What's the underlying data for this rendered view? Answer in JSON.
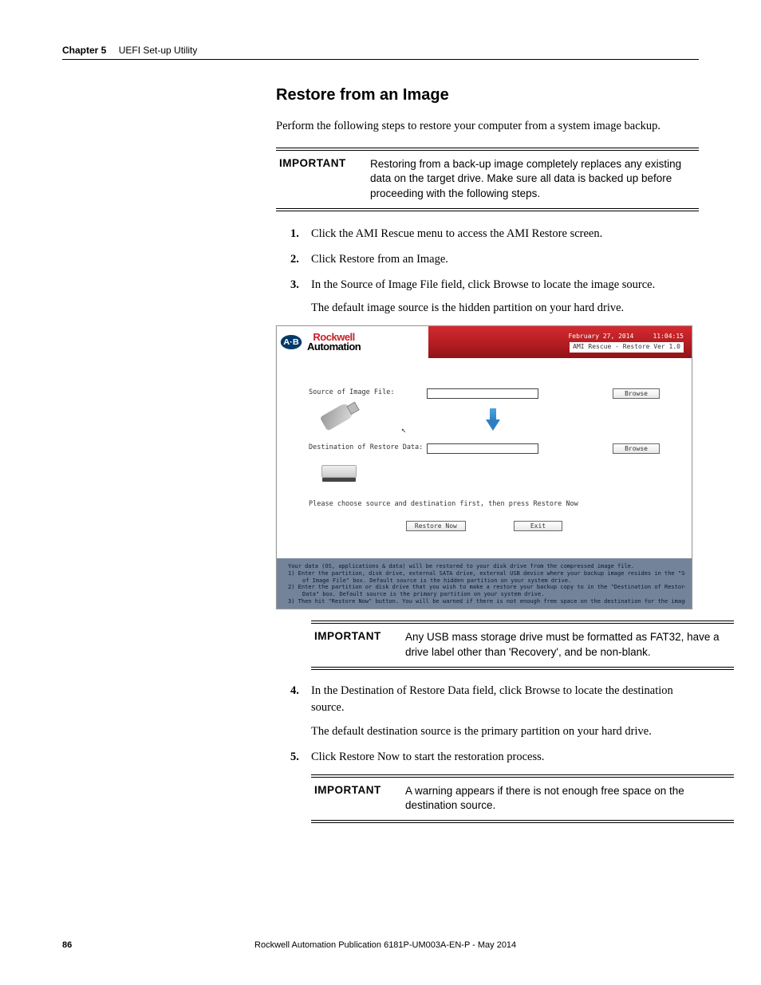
{
  "header": {
    "chapter_label": "Chapter 5",
    "chapter_title": "UEFI Set-up Utility"
  },
  "section": {
    "title": "Restore from an Image",
    "intro": "Perform the following steps to restore your computer from a system image backup."
  },
  "callout1": {
    "label": "IMPORTANT",
    "text": "Restoring from a back-up image completely replaces any existing data on the target drive. Make sure all data is backed up before proceeding with the following steps."
  },
  "steps": {
    "s1": "Click the AMI Rescue menu to access the AMI Restore screen.",
    "s2": "Click Restore from an Image.",
    "s3": "In the Source of Image File field, click Browse to locate the image source.",
    "s3_sub": "The default image source is the hidden partition on your hard drive.",
    "s4": "In the Destination of Restore Data field, click Browse to locate the destination source.",
    "s4_sub": "The default destination source is the primary partition on your hard drive.",
    "s5": "Click Restore Now to start the restoration process."
  },
  "screenshot": {
    "logo_line1": "Rockwell",
    "logo_line2": "Automation",
    "ab_badge": "A·B",
    "date": "February 27, 2014",
    "time": "11:04:15",
    "version": "AMI Rescue - Restore Ver 1.0",
    "source_label": "Source of Image File:",
    "dest_label": "Destination of Restore Data:",
    "browse_btn": "Browse",
    "instruction": "Please choose source and destination first, then press Restore Now",
    "restore_btn": "Restore Now",
    "exit_btn": "Exit",
    "footer_main": "Your data (OS, applications & data) will be restored to your disk drive from the compressed image file.",
    "footer_1a": "1) Enter the partition, disk drive, external SATA drive, external USB device where your backup image resides in the \"Source",
    "footer_1b": "of Image File\" box. Default source is the hidden partition on your system drive.",
    "footer_2a": "2) Enter the partition or disk drive that you wish to make a restore your backup copy to in the \"Destination of Restore",
    "footer_2b": "Data\" box. Default source is the primary partition on your system drive.",
    "footer_3": "3) Then hit \"Restore Now\" button. You will be warned if there is not enough free space on the destination for the image."
  },
  "callout2": {
    "label": "IMPORTANT",
    "text": "Any USB mass storage drive must be formatted as FAT32, have a drive label other than 'Recovery', and be non-blank."
  },
  "callout3": {
    "label": "IMPORTANT",
    "text": "A warning appears if there is not enough free space on the destination source."
  },
  "footer": {
    "page_number": "86",
    "publication": "Rockwell Automation Publication 6181P-UM003A-EN-P - May 2014"
  }
}
